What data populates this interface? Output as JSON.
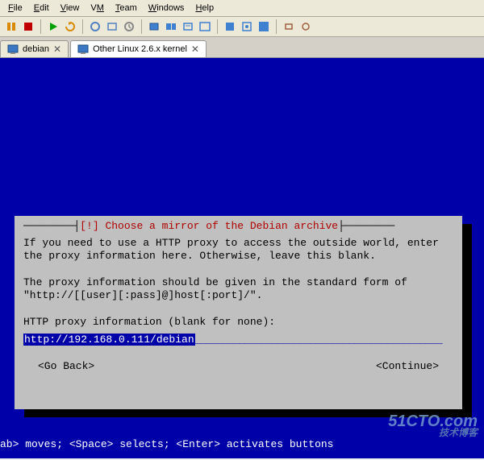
{
  "menu": {
    "file": "File",
    "edit": "Edit",
    "view": "View",
    "vm": "VM",
    "team": "Team",
    "windows": "Windows",
    "help": "Help"
  },
  "tabs": {
    "debian": "debian",
    "other": "Other Linux 2.6.x kernel"
  },
  "dialog": {
    "title_prefix": "[!] ",
    "title": "Choose a mirror of the Debian archive",
    "body": "If you need to use a HTTP proxy to access the outside world, enter\nthe proxy information here. Otherwise, leave this blank.\n\nThe proxy information should be given in the standard form of\n\"http://[[user][:pass]@]host[:port]/\".\n\nHTTP proxy information (blank for none):",
    "input_value": "http://192.168.0.111/debian",
    "go_back": "<Go Back>",
    "continue": "<Continue>"
  },
  "status": "ab> moves; <Space> selects; <Enter> activates buttons",
  "watermark": {
    "main": "51CTO.com",
    "sub": "技术博客"
  }
}
